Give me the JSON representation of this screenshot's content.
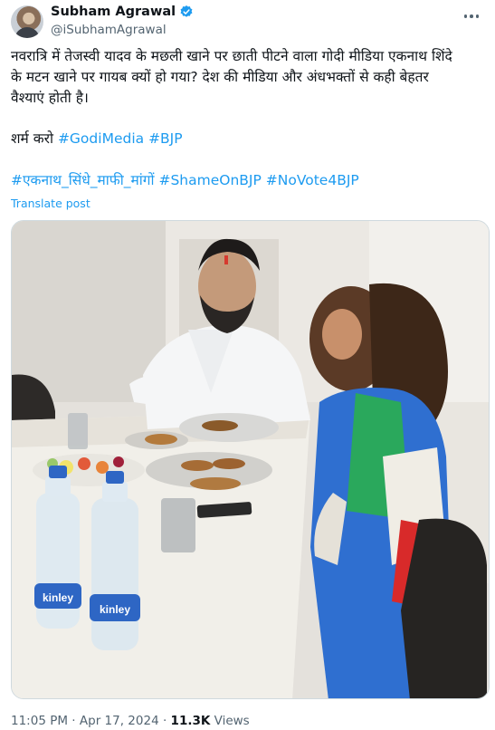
{
  "author": {
    "display_name": "Subham Agrawal",
    "handle": "@iSubhamAgrawal",
    "verified": true
  },
  "tweet": {
    "line1": "नवरात्रि में तेजस्वी यादव के मछली खाने पर छाती पीटने वाला गोदी मीडिया एकनाथ शिंदे",
    "line2": "के मटन खाने पर गायब क्यों हो गया? देश की मीडिया और अंधभक्तों से कही बेहतर",
    "line3": "वैश्याएं होती है।",
    "shame_text": "शर्म करो",
    "tags1": [
      "#GodiMedia",
      "#BJP"
    ],
    "tags2": [
      "#एकनाथ_सिंधे_माफी_मांगों",
      "#ShameOnBJP",
      "#NoVote4BJP"
    ],
    "translate_label": "Translate post"
  },
  "media": {
    "bottle_label_1": "kinley",
    "bottle_label_2": "kinley"
  },
  "meta": {
    "time": "11:05 PM",
    "separator": "·",
    "date": "Apr 17, 2024",
    "views_count": "11.3K",
    "views_label": "Views"
  },
  "icons": [
    "verified-badge-icon",
    "more-options-icon"
  ],
  "colors": {
    "link": "#1d9bf0",
    "text": "#0f1419",
    "secondary": "#536471",
    "verified": "#1d9bf0"
  }
}
